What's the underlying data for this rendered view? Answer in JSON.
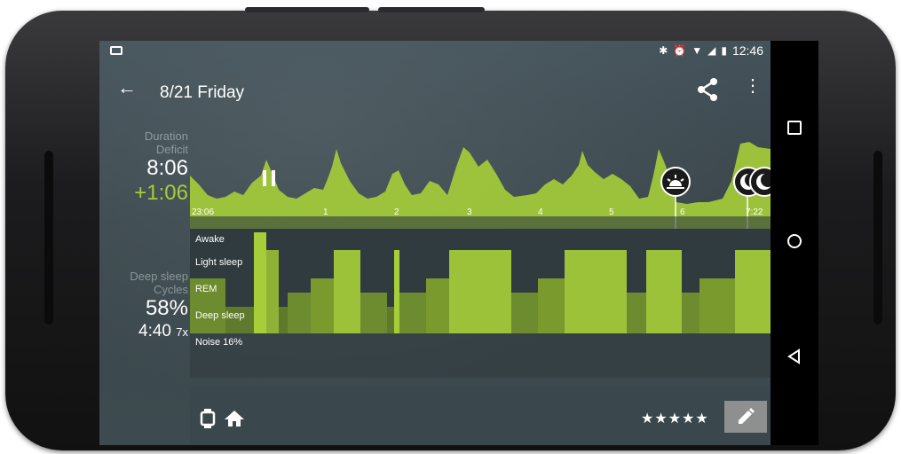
{
  "status_bar": {
    "time": "12:46",
    "icons": [
      "bluetooth-icon",
      "alarm-icon",
      "wifi-icon",
      "signal-icon",
      "battery-icon"
    ]
  },
  "app_bar": {
    "title": "8/21 Friday"
  },
  "stats": {
    "duration_label": "Duration",
    "deficit_label": "Deficit",
    "duration_value": "8:06",
    "deficit_value": "+1:06",
    "deep_sleep_label": "Deep sleep",
    "cycles_label": "Cycles",
    "deep_sleep_value": "58%",
    "cycles_value": "4:40",
    "cycles_count": "7x"
  },
  "chart": {
    "start_time_label": "23:06",
    "hour_ticks": [
      "1",
      "2",
      "3",
      "4",
      "5",
      "6"
    ],
    "end_time_label": "7:22"
  },
  "hypnogram": {
    "levels": [
      "Awake",
      "Light sleep",
      "REM",
      "Deep sleep"
    ]
  },
  "noise": {
    "label": "Noise 16%"
  },
  "footer": {
    "rating": "★★★★★"
  },
  "colors": {
    "accent": "#a6ce39",
    "accent_dark": "#7a9a2e",
    "background": "#3e4a4e"
  }
}
